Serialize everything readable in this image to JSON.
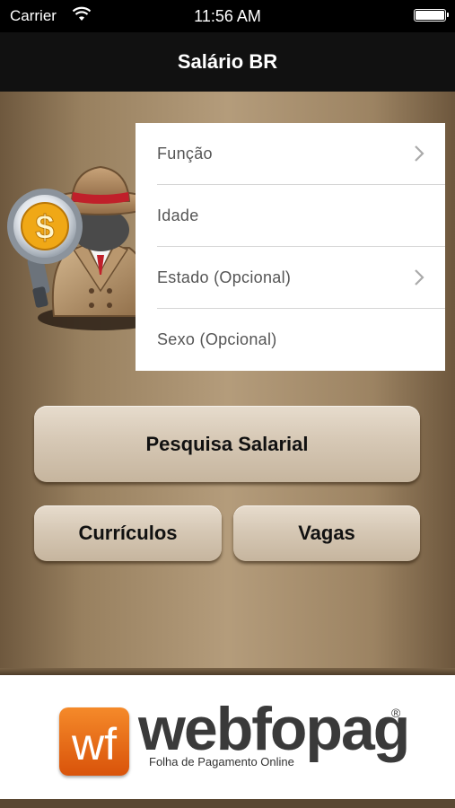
{
  "status_bar": {
    "carrier": "Carrier",
    "time": "11:56 AM"
  },
  "nav": {
    "title": "Salário BR"
  },
  "form": {
    "rows": [
      {
        "label": "Função",
        "has_chevron": true
      },
      {
        "label": "Idade",
        "has_chevron": false
      },
      {
        "label": "Estado (Opcional)",
        "has_chevron": true
      },
      {
        "label": "Sexo (Opcional)",
        "has_chevron": false
      }
    ]
  },
  "buttons": {
    "pesquisa": "Pesquisa Salarial",
    "curriculos": "Currículos",
    "vagas": "Vagas"
  },
  "mascot": {
    "symbol": "$"
  },
  "footer": {
    "logo_mark": "wf",
    "brand": "webfopag",
    "registered": "®",
    "tagline": "Folha de Pagamento Online"
  },
  "colors": {
    "brand_orange": "#e8701a",
    "nav_bg": "#111111",
    "main_bg": "#a88f6e"
  },
  "icons": [
    "wifi-icon",
    "battery-icon",
    "chevron-right-icon",
    "detective-mascot-icon",
    "webfopag-logo-icon"
  ]
}
